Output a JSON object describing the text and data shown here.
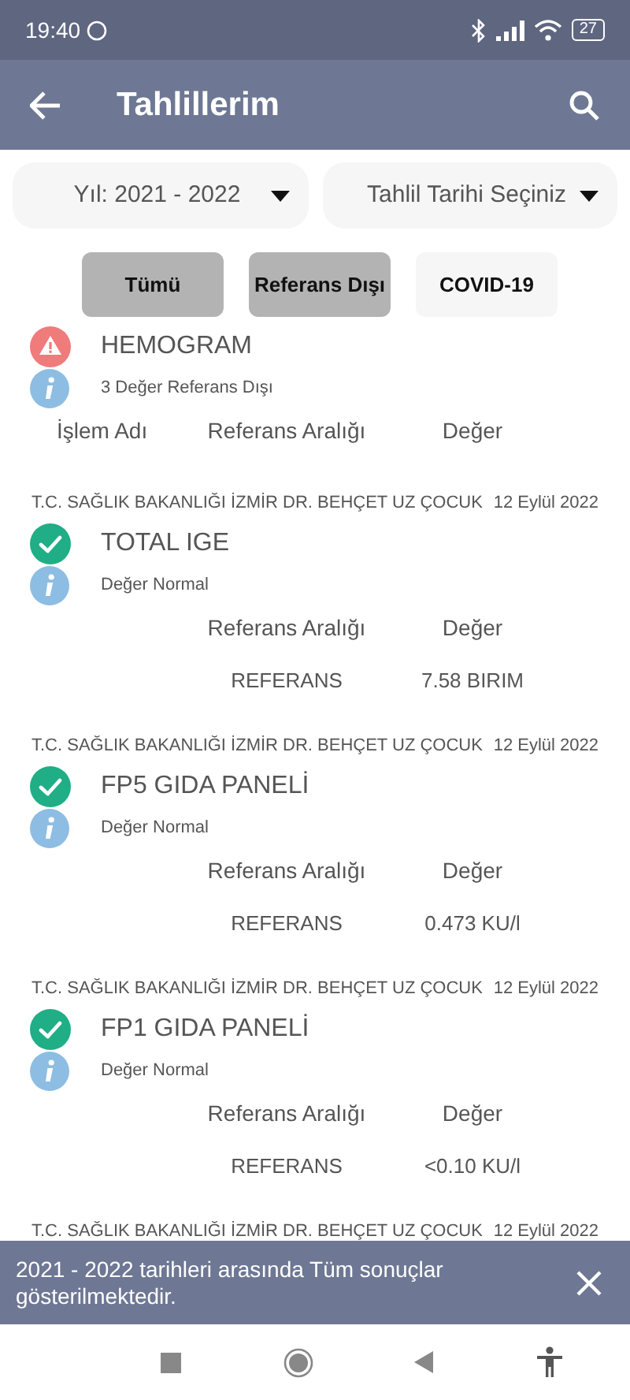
{
  "status_bar": {
    "time": "19:40",
    "battery": "27"
  },
  "app_bar": {
    "title": "Tahlillerim"
  },
  "dropdowns": [
    {
      "value": "Yıl: 2021 - 2022"
    },
    {
      "value": "Tahlil Tarihi Seçiniz"
    }
  ],
  "filters": [
    {
      "label": "Tümü",
      "selected": true
    },
    {
      "label": "Referans Dışı",
      "selected": true
    },
    {
      "label": "COVID-19",
      "selected": false
    }
  ],
  "results": [
    {
      "kind": "alert",
      "name": "HEMOGRAM",
      "note": "3 Değer Referans Dışı",
      "columns": [
        "İşlem Adı",
        "Referans Aralığı",
        "Değer"
      ]
    },
    {
      "hospital": "T.C. SAĞLIK BAKANLIĞI İZMİR DR. BEHÇET UZ ÇOCUK",
      "date": "12 Eylül 2022",
      "kind": "normal",
      "name": "TOTAL IGE",
      "note": "Değer Normal",
      "columns": [
        "Referans Aralığı",
        "Değer"
      ],
      "values": [
        "REFERANS",
        "7.58 BIRIM"
      ]
    },
    {
      "hospital": "T.C. SAĞLIK BAKANLIĞI İZMİR DR. BEHÇET UZ ÇOCUK",
      "date": "12 Eylül 2022",
      "kind": "normal",
      "name": "FP5 GIDA PANELİ",
      "note": "Değer Normal",
      "columns": [
        "Referans Aralığı",
        "Değer"
      ],
      "values": [
        "REFERANS",
        "0.473 KU/l"
      ]
    },
    {
      "hospital": "T.C. SAĞLIK BAKANLIĞI İZMİR DR. BEHÇET UZ ÇOCUK",
      "date": "12 Eylül 2022",
      "kind": "normal",
      "name": "FP1 GIDA PANELİ",
      "note": "Değer Normal",
      "columns": [
        "Referans Aralığı",
        "Değer"
      ],
      "values": [
        "REFERANS",
        "<0.10 KU/l"
      ]
    },
    {
      "hospital": "T.C. SAĞLIK BAKANLIĞI İZMİR DR. BEHÇET UZ ÇOCUK",
      "date": "12 Eylül 2022"
    }
  ],
  "snackbar": {
    "message": "2021 - 2022 tarihleri arasında Tüm sonuçlar gösterilmektedir."
  }
}
